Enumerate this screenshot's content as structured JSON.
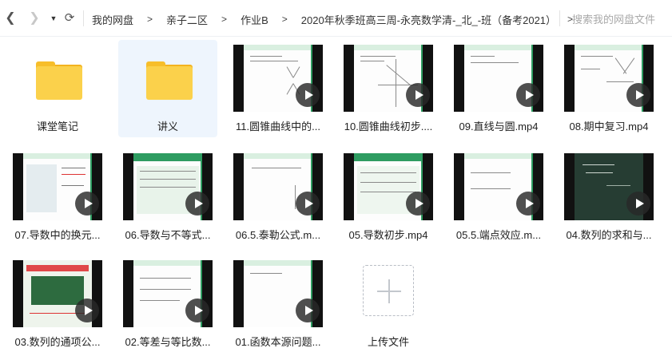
{
  "toolbar": {
    "back_icon": "chevron-left-icon",
    "forward_icon": "chevron-right-icon",
    "history_icon": "caret-down-icon",
    "refresh_icon": "refresh-icon"
  },
  "breadcrumb": [
    "我的网盘",
    "亲子二区",
    "作业B",
    "2020年秋季班高三周-永亮数学清-_北_-班（备考2021）"
  ],
  "search": {
    "placeholder": "搜索我的网盘文件"
  },
  "items": [
    {
      "name": "课堂笔记",
      "kind": "folder"
    },
    {
      "name": "讲义",
      "kind": "folder",
      "selected": true
    },
    {
      "name": "11.圆锥曲线中的...",
      "kind": "video"
    },
    {
      "name": "10.圆锥曲线初步....",
      "kind": "video"
    },
    {
      "name": "09.直线与圆.mp4",
      "kind": "video"
    },
    {
      "name": "08.期中复习.mp4",
      "kind": "video"
    },
    {
      "name": "07.导数中的换元...",
      "kind": "video"
    },
    {
      "name": "06.导数与不等式...",
      "kind": "video"
    },
    {
      "name": "06.5.泰勒公式.m...",
      "kind": "video"
    },
    {
      "name": "05.导数初步.mp4",
      "kind": "video"
    },
    {
      "name": "05.5.端点效应.m...",
      "kind": "video"
    },
    {
      "name": "04.数列的求和与...",
      "kind": "video"
    },
    {
      "name": "03.数列的通项公...",
      "kind": "video"
    },
    {
      "name": "02.等差与等比数...",
      "kind": "video"
    },
    {
      "name": "01.函数本源问题...",
      "kind": "video"
    },
    {
      "name": "上传文件",
      "kind": "upload"
    }
  ],
  "colors": {
    "folder": "#fbd14b",
    "selected_bg": "#eef5fd",
    "slide_accent": "#2e9c61"
  }
}
